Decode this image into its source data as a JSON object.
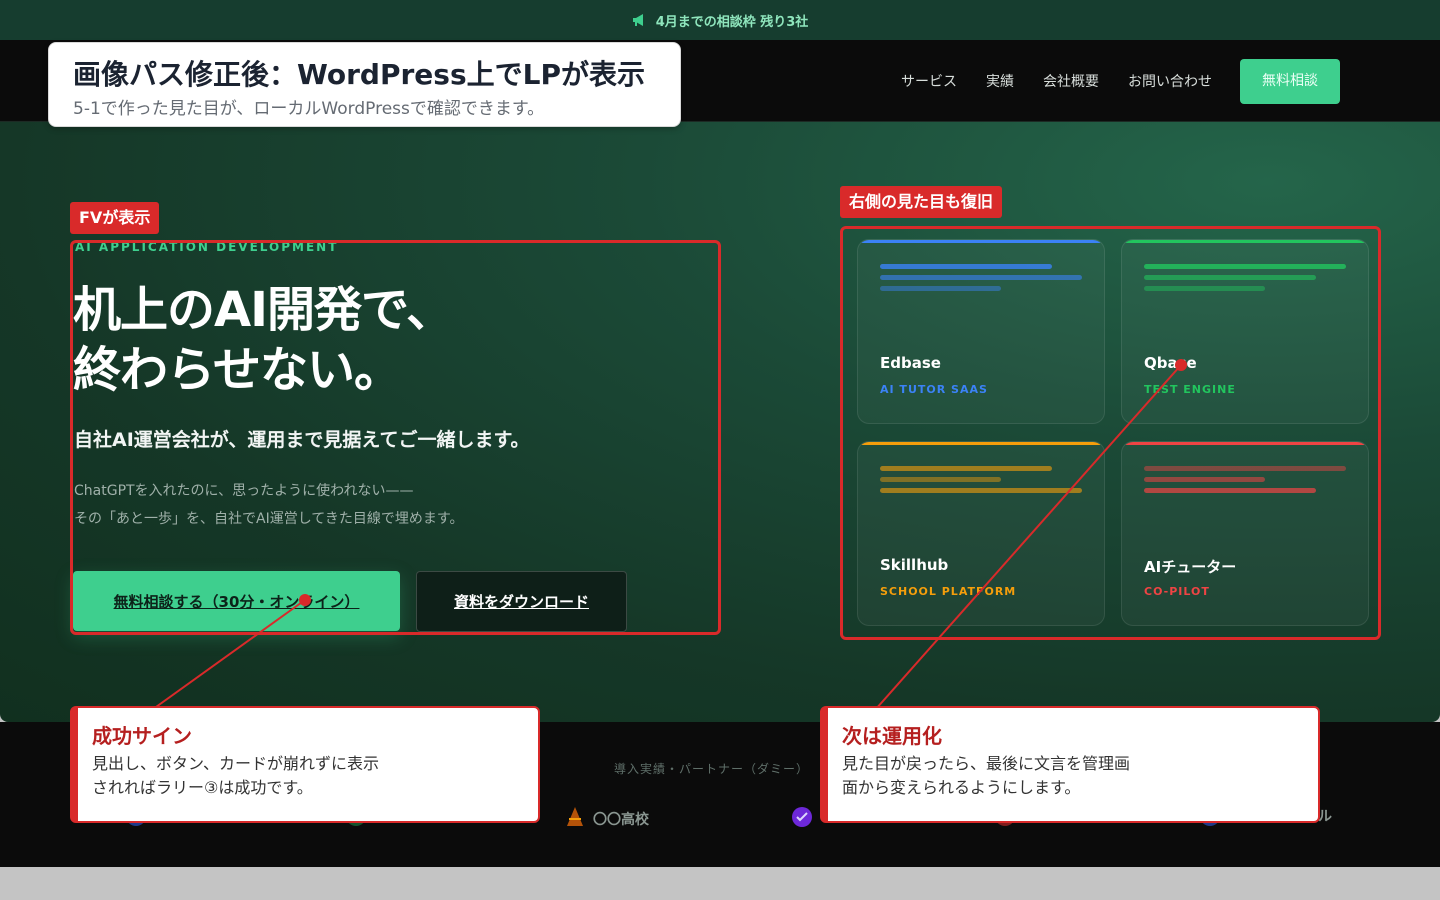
{
  "announcement": {
    "icon": "megaphone-icon",
    "text": "4月までの相談枠 残り3社"
  },
  "nav": {
    "items": [
      "サービス",
      "実績",
      "会社概要",
      "お問い合わせ"
    ],
    "cta": "無料相談"
  },
  "hero": {
    "eyebrow": "AI APPLICATION DEVELOPMENT",
    "headline_line1": "机上のAI開発で、",
    "headline_line2": "終わらせない。",
    "lead": "自社AI運営会社が、運用まで見据えてご一緒します。",
    "sub_line1": "ChatGPTを入れたのに、思ったように使われない——",
    "sub_line2": "その「あと一歩」を、自社でAI運営してきた目線で埋めます。",
    "primary_button": "無料相談する（30分・オンライン）",
    "secondary_button": "資料をダウンロード"
  },
  "cards": [
    {
      "name": "Edbase",
      "tag": "AI TUTOR SAAS",
      "accent": "#3b82f6"
    },
    {
      "name": "Qbase",
      "tag": "TEST ENGINE",
      "accent": "#22c55e"
    },
    {
      "name": "Skillhub",
      "tag": "SCHOOL PLATFORM",
      "accent": "#f59e0b"
    },
    {
      "name": "AIチューター",
      "tag": "CO-PILOT",
      "accent": "#ef4444"
    }
  ],
  "partners": {
    "title": "導入実績・パートナー（ダミー）",
    "visible_logo": "〇〇高校",
    "tail_text": "ル"
  },
  "annotations": {
    "title": "画像パス修正後：WordPress上でLPが表示",
    "subtitle": "5-1で作った見た目が、ローカルWordPressで確認できます。",
    "fv_tag": "FVが表示",
    "right_tag": "右側の見た目も復旧",
    "note_success_heading": "成功サイン",
    "note_success_line1": "見出し、ボタン、カードが崩れずに表示",
    "note_success_line2": "されればラリー③は成功です。",
    "note_next_heading": "次は運用化",
    "note_next_line1": "見た目が戻ったら、最後に文言を管理画",
    "note_next_line2": "面から変えられるようにします。",
    "accent_color": "#d92a2a"
  },
  "colors": {
    "brand_green": "#3ecf8e",
    "announce_bg": "#163d2f",
    "header_bg": "#0b0b0b"
  }
}
